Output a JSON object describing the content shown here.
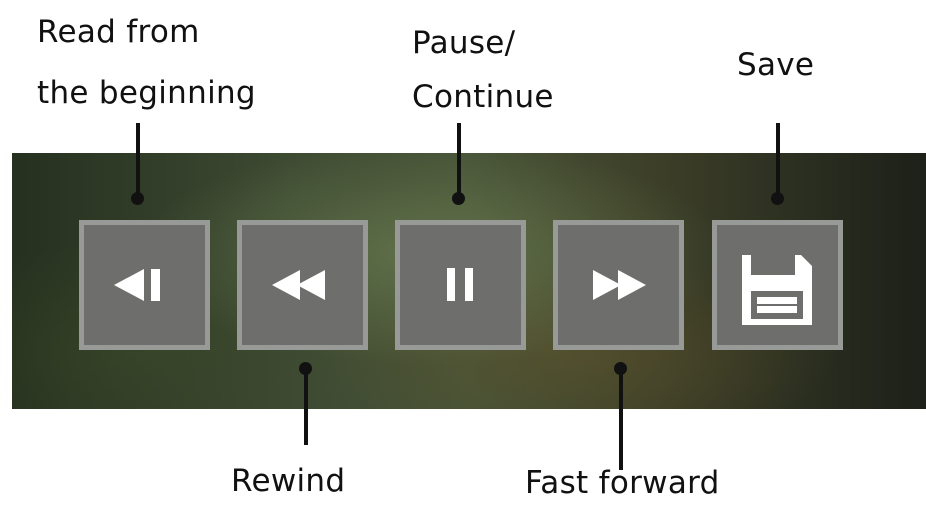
{
  "labels": {
    "read_from_beginning_line1": "Read from",
    "read_from_beginning_line2": "the beginning",
    "pause_line1": "Pause/",
    "pause_line2": "Continue",
    "save": "Save",
    "rewind": "Rewind",
    "fast_forward": "Fast forward"
  },
  "colors": {
    "button_fill": "#6e6f6c",
    "button_border": "#979a96",
    "icon": "#ffffff",
    "callout": "#111111"
  },
  "buttons": [
    {
      "name": "read-from-beginning-button",
      "icon": "skip-to-start-icon"
    },
    {
      "name": "rewind-button",
      "icon": "rewind-icon"
    },
    {
      "name": "pause-continue-button",
      "icon": "pause-icon"
    },
    {
      "name": "fast-forward-button",
      "icon": "fast-forward-icon"
    },
    {
      "name": "save-button",
      "icon": "floppy-disk-icon"
    }
  ]
}
